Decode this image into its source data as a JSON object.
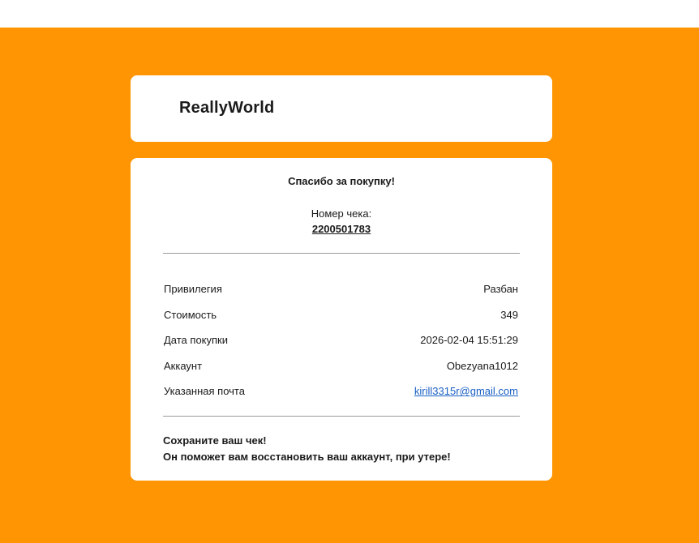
{
  "header": {
    "brand": "ReallyWorld"
  },
  "receipt": {
    "thanks": "Спасибо за покупку!",
    "number_label": "Номер чека:",
    "number": "2200501783",
    "rows": [
      {
        "label": "Привилегия",
        "value": "Разбан"
      },
      {
        "label": "Стоимость",
        "value": "349"
      },
      {
        "label": "Дата покупки",
        "value": "2026-02-04 15:51:29"
      },
      {
        "label": "Аккаунт",
        "value": "Obezyana1012"
      },
      {
        "label": "Указанная почта",
        "value": "kirill3315r@gmail.com"
      }
    ],
    "footer_line1": "Сохраните ваш чек!",
    "footer_line2": "Он поможет вам восстановить ваш аккаунт, при утере!"
  },
  "colors": {
    "background": "#ff9502",
    "card": "#ffffff",
    "link": "#1a5fc4"
  }
}
